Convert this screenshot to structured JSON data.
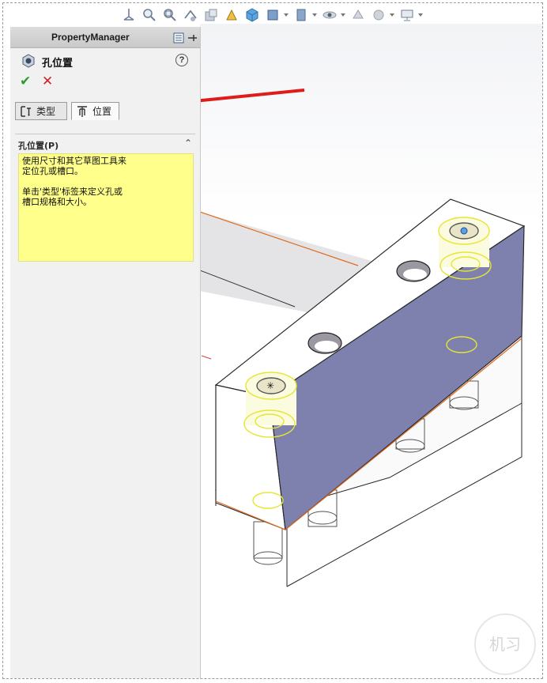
{
  "property_manager": {
    "title": "PropertyManager",
    "feature_name": "孔位置",
    "help_label": "?",
    "ok_symbol": "✔",
    "cancel_symbol": "✕",
    "tabs": [
      {
        "label": "类型",
        "icon": "hole-type-icon",
        "selected": false
      },
      {
        "label": "位置",
        "icon": "hole-position-icon",
        "selected": true
      }
    ],
    "section": {
      "title": "孔位置(P)",
      "collapse_symbol": "⌃",
      "message_lines": [
        "使用尺寸和其它草图工具来",
        "定位孔或槽口。"
      ],
      "message_lines_2": [
        "单击'类型'标签来定义孔或",
        "槽口规格和大小。"
      ]
    }
  },
  "toolbar": {
    "icons": [
      "view-orientation-icon",
      "zoom-to-fit-icon",
      "zoom-area-icon",
      "previous-view-icon",
      "section-view-icon",
      "dynamic-annotation-icon",
      "view-cube-icon",
      "display-style-icon",
      "hide-show-items-icon",
      "edit-appearance-icon",
      "apply-scene-icon",
      "view-settings-icon",
      "display-icon"
    ]
  },
  "colors": {
    "face_blue": "#7e80ae",
    "highlight_yellow": "#ffff8c",
    "arrow_red": "#e01b1b",
    "edge_orange": "#e06a20",
    "accept_green": "#2e9b2e",
    "cancel_red": "#cc2222"
  },
  "watermark": {
    "text": "机习"
  }
}
